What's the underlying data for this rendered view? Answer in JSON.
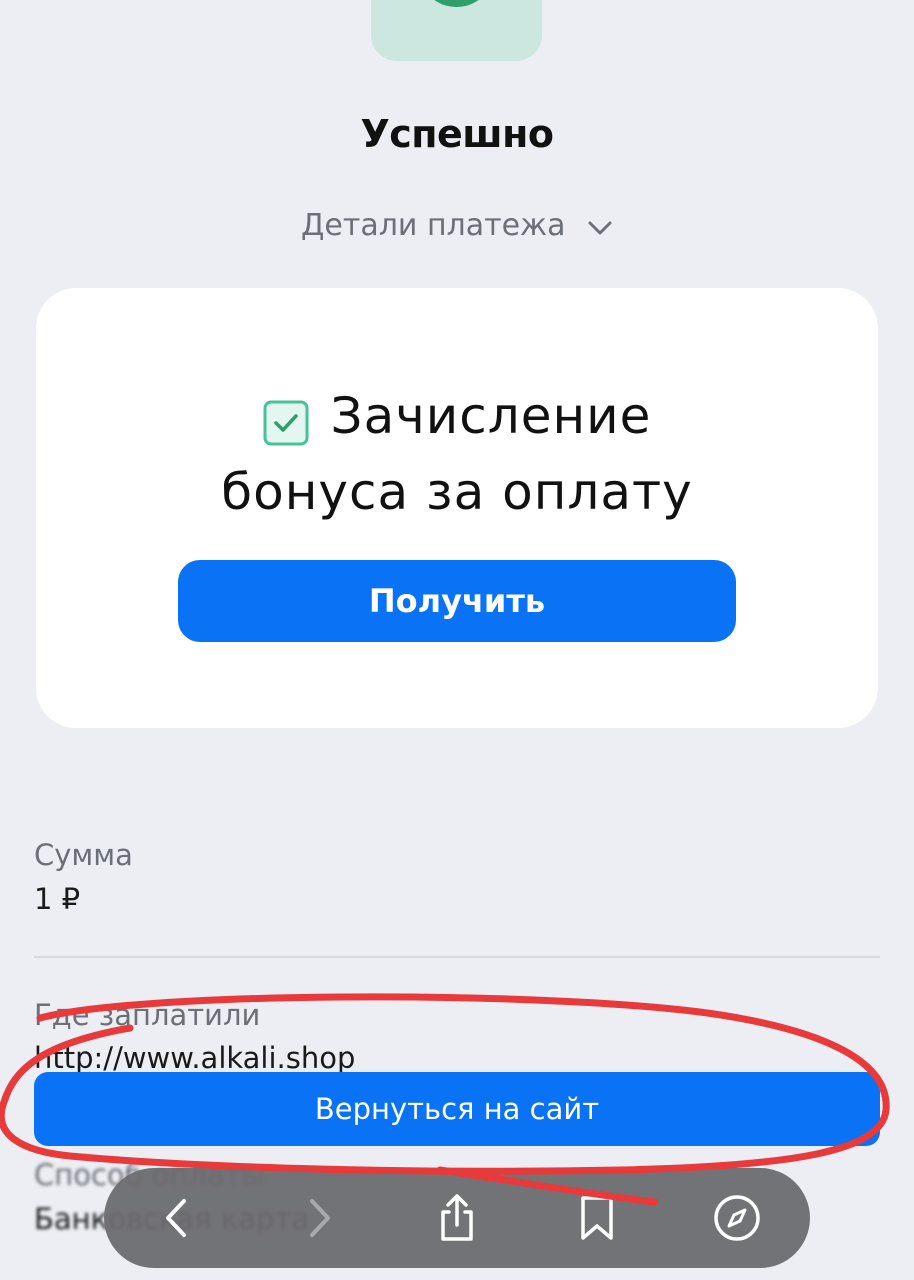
{
  "page": {
    "title": "Успешно",
    "details_toggle": "Детали платежа"
  },
  "bonus_card": {
    "line1": "Зачисление",
    "line2": "бонуса за оплату",
    "button_label": "Получить"
  },
  "fields": {
    "amount_label": "Сумма",
    "amount_value": "1 ₽",
    "where_label": "Где заплатили",
    "where_value": "http://www.alkali.shop",
    "method_label": "Способ оплаты",
    "method_value": "Банковская карта"
  },
  "return_button": {
    "label": "Вернуться на сайт"
  },
  "toolbar": {
    "icons": [
      "back-icon",
      "forward-icon",
      "share-icon",
      "bookmarks-icon",
      "compass-icon"
    ]
  },
  "colors": {
    "background": "#ECEEF3",
    "accent": "#0A72F5",
    "success_green": "#2E9E6A",
    "annotation_red": "#E83A3A"
  }
}
